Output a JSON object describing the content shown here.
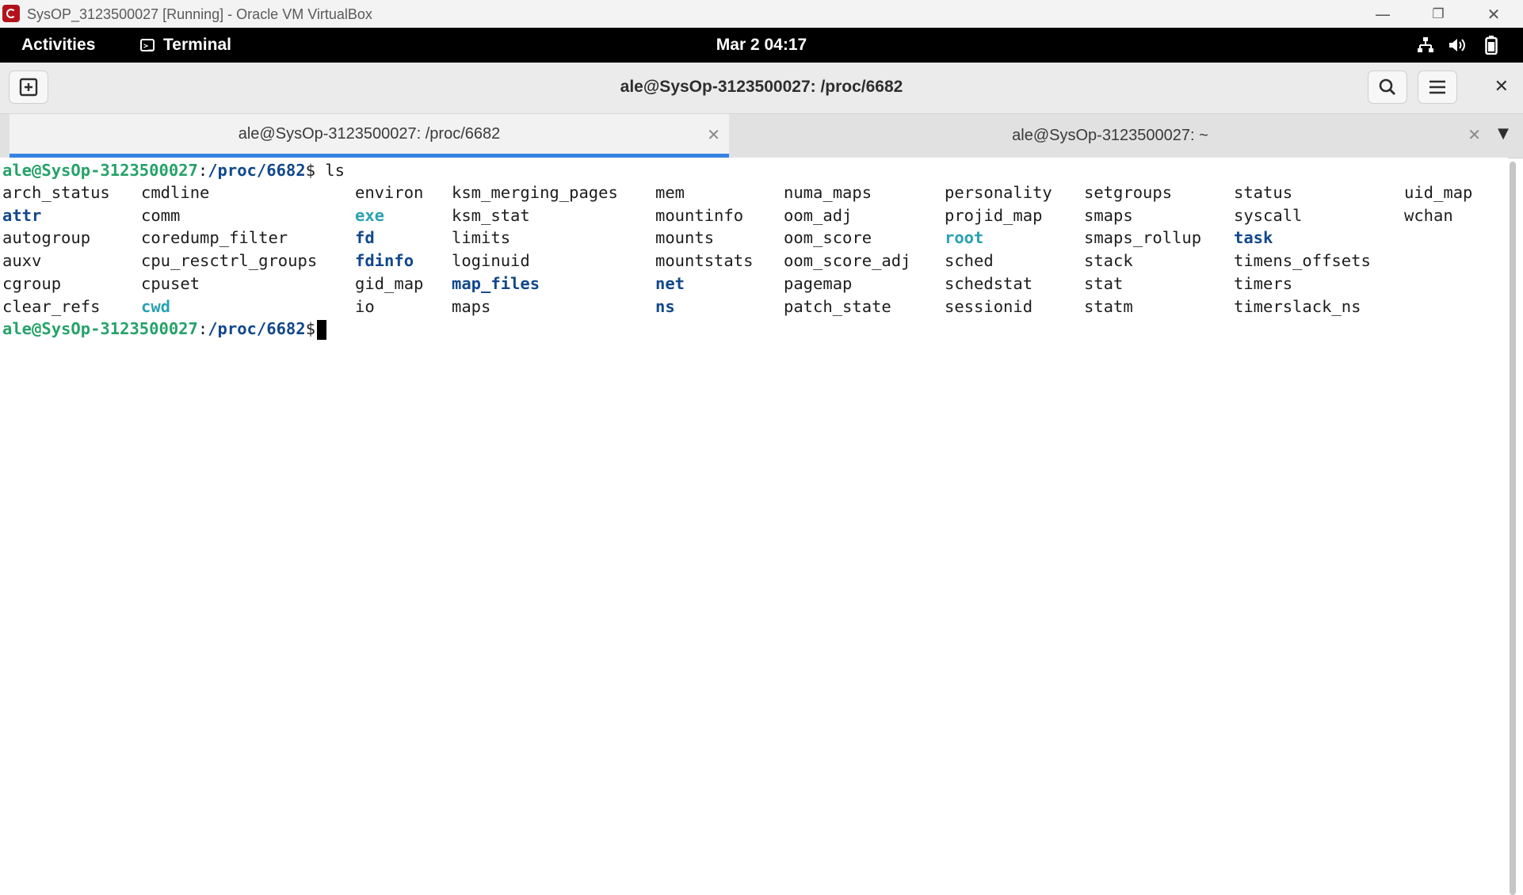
{
  "host_window": {
    "title": "SysOP_3123500027 [Running] - Oracle VM VirtualBox",
    "controls": {
      "minimize": "—",
      "restore": "❐",
      "close": "✕"
    }
  },
  "gnome_topbar": {
    "activities": "Activities",
    "app_name": "Terminal",
    "clock": "Mar 2  04:17",
    "tray": {
      "network": "network-icon",
      "volume": "volume-icon",
      "battery": "battery-icon"
    }
  },
  "terminal": {
    "window_title": "ale@SysOp-3123500027: /proc/6682",
    "tabs": [
      {
        "label": "ale@SysOp-3123500027: /proc/6682",
        "active": true
      },
      {
        "label": "ale@SysOp-3123500027: ~",
        "active": false
      }
    ],
    "colors": {
      "user_host": "#26a269",
      "path": "#12488b",
      "directory": "#12488b",
      "symlink": "#2aa1b3",
      "tab_indicator": "#3584e4"
    },
    "prompt": {
      "user_host": "ale@SysOp-3123500027",
      "colon": ":",
      "path": "/proc/6682",
      "dollar": "$",
      "command": " ls"
    },
    "ls_columns": [
      [
        "arch_status",
        "attr",
        "autogroup",
        "auxv",
        "cgroup",
        "clear_refs"
      ],
      [
        "cmdline",
        "comm",
        "coredump_filter",
        "cpu_resctrl_groups",
        "cpuset",
        "cwd"
      ],
      [
        "environ",
        "exe",
        "fd",
        "fdinfo",
        "gid_map",
        "io"
      ],
      [
        "ksm_merging_pages",
        "ksm_stat",
        "limits",
        "loginuid",
        "map_files",
        "maps"
      ],
      [
        "mem",
        "mountinfo",
        "mounts",
        "mountstats",
        "net",
        "ns"
      ],
      [
        "numa_maps",
        "oom_adj",
        "oom_score",
        "oom_score_adj",
        "pagemap",
        "patch_state"
      ],
      [
        "personality",
        "projid_map",
        "root",
        "sched",
        "schedstat",
        "sessionid"
      ],
      [
        "setgroups",
        "smaps",
        "smaps_rollup",
        "stack",
        "stat",
        "statm"
      ],
      [
        "status",
        "syscall",
        "task",
        "timens_offsets",
        "timers",
        "timerslack_ns"
      ],
      [
        "uid_map",
        "wchan"
      ]
    ],
    "directories": [
      "attr",
      "fd",
      "fdinfo",
      "map_files",
      "net",
      "ns",
      "task"
    ],
    "symlinks": [
      "exe",
      "cwd",
      "root"
    ]
  }
}
